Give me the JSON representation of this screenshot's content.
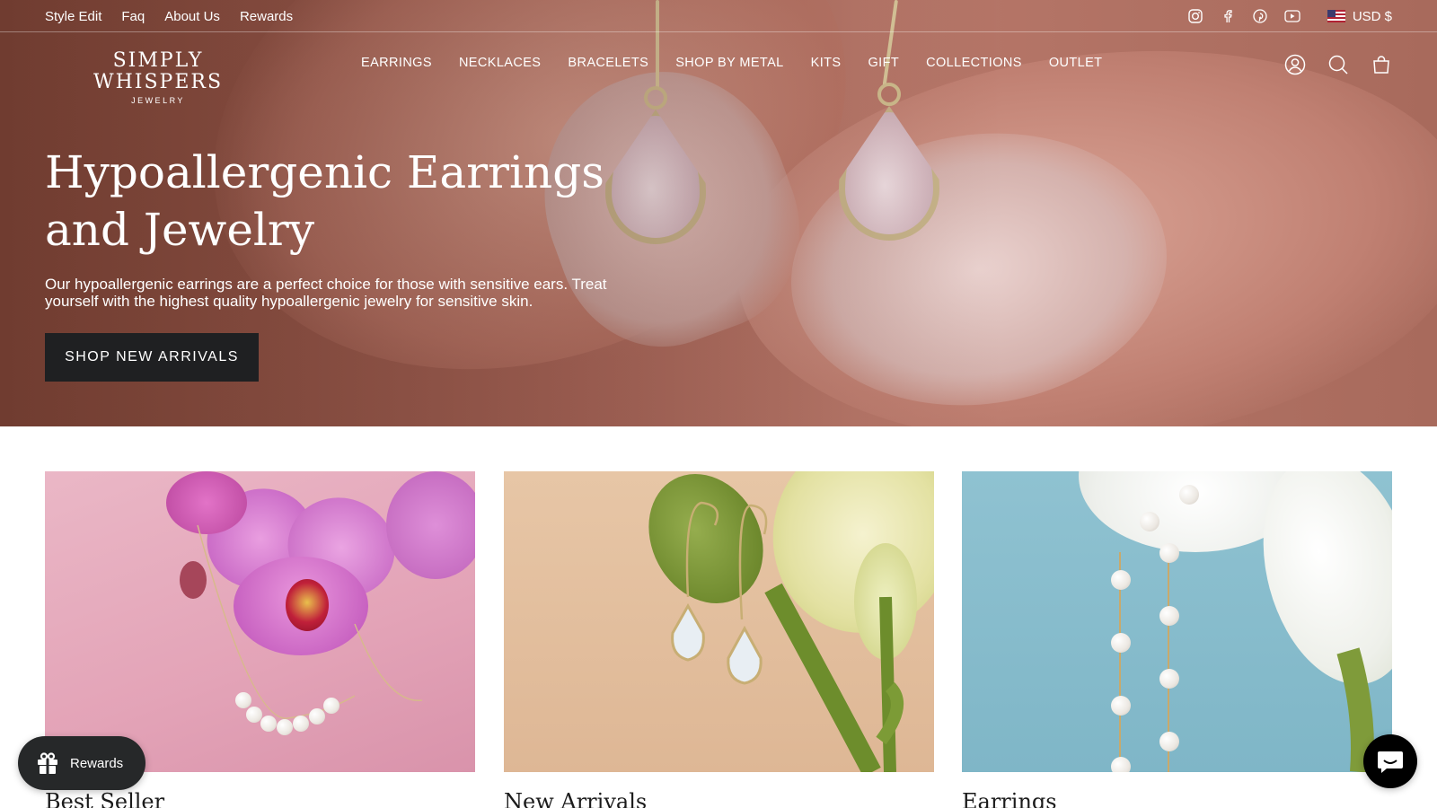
{
  "utility_bar": {
    "links": [
      "Style Edit",
      "Faq",
      "About Us",
      "Rewards"
    ],
    "social_icons": [
      "instagram-icon",
      "facebook-icon",
      "pinterest-icon",
      "youtube-icon"
    ],
    "currency": "USD $"
  },
  "brand": {
    "name": "SIMPLY WHISPERS",
    "subname": "JEWELRY"
  },
  "main_nav": {
    "items": [
      "EARRINGS",
      "NECKLACES",
      "BRACELETS",
      "SHOP BY METAL",
      "KITS",
      "GIFT",
      "COLLECTIONS",
      "OUTLET"
    ],
    "icons": [
      "account-icon",
      "search-icon",
      "cart-icon"
    ]
  },
  "hero": {
    "title": "Hypoallergenic Earrings and Jewelry",
    "description": "Our hypoallergenic earrings are a perfect choice for those with sensitive ears. Treat yourself with the highest quality hypoallergenic jewelry for sensitive skin.",
    "cta_label": "SHOP NEW ARRIVALS"
  },
  "collections": [
    {
      "title": "Best Seller"
    },
    {
      "title": "New Arrivals"
    },
    {
      "title": "Earrings"
    }
  ],
  "widgets": {
    "rewards_label": "Rewards",
    "chat_icon": "chat-icon"
  },
  "colors": {
    "cta_background": "#1f2022",
    "widget_background": "#262829"
  }
}
